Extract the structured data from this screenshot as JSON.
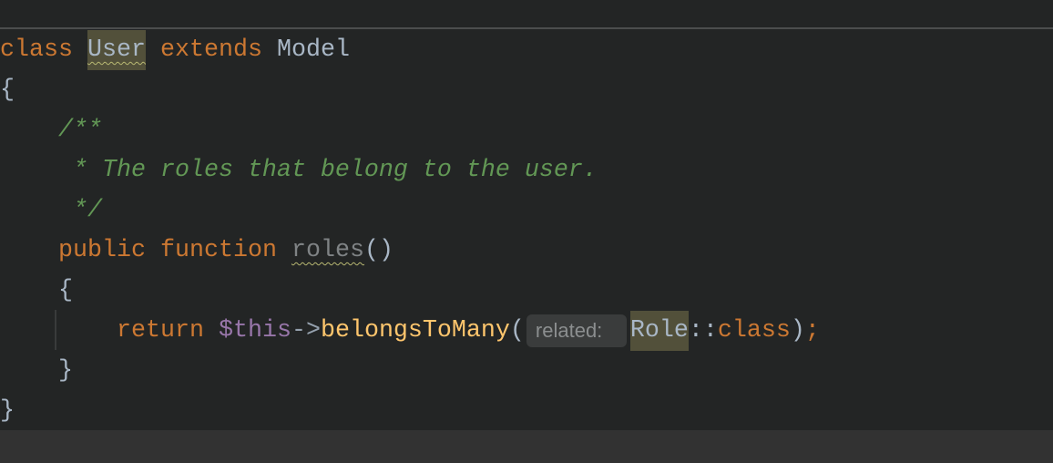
{
  "editor": {
    "language": "php",
    "lines": {
      "l1": {
        "kw_class": "class",
        "class_name": "User",
        "kw_extends": "extends",
        "parent": "Model"
      },
      "l2": {
        "brace": "{"
      },
      "l3": {
        "comment": "    /**"
      },
      "l4": {
        "comment": "     * The roles that belong to the user."
      },
      "l5": {
        "comment": "     */"
      },
      "l6": {
        "indent": "    ",
        "kw_public": "public",
        "kw_function": "function",
        "method_name": "roles",
        "parens": "()"
      },
      "l7": {
        "brace": "    {"
      },
      "l8": {
        "indent": "        ",
        "kw_return": "return",
        "this_var": "$this",
        "arrow": "->",
        "call": "belongsToMany",
        "open_paren": "(",
        "inlay_hint": "related:",
        "arg_class": "Role",
        "scope_op": "::",
        "kw_class": "class",
        "close": ");"
      },
      "l9": {
        "brace": "    }"
      },
      "l10": {
        "brace": "}"
      }
    },
    "colors": {
      "background": "#232525",
      "keyword": "#cc7832",
      "comment": "#629755",
      "variable": "#9876aa",
      "method_call": "#ffc66d",
      "identifier": "#a9b7c6",
      "highlight": "#52503a"
    }
  }
}
